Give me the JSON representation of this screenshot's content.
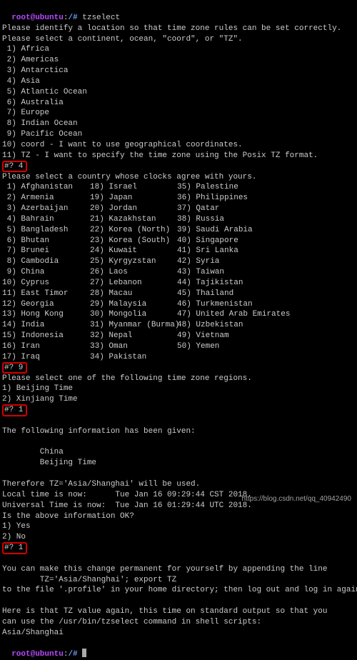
{
  "prompt": {
    "user_host": "root@ubuntu",
    "colon": ":",
    "path": "/#",
    "cmd_tzselect": " tzselect",
    "cmd_end": " "
  },
  "intro": {
    "l1": "Please identify a location so that time zone rules can be set correctly.",
    "l2": "Please select a continent, ocean, \"coord\", or \"TZ\"."
  },
  "continents": [
    " 1) Africa",
    " 2) Americas",
    " 3) Antarctica",
    " 4) Asia",
    " 5) Atlantic Ocean",
    " 6) Australia",
    " 7) Europe",
    " 8) Indian Ocean",
    " 9) Pacific Ocean",
    "10) coord - I want to use geographical coordinates.",
    "11) TZ - I want to specify the time zone using the Posix TZ format."
  ],
  "answer1": "#? 4",
  "country_prompt": "Please select a country whose clocks agree with yours.",
  "countries": [
    {
      "c1": " 1) Afghanistan",
      "c2": "18) Israel",
      "c3": "35) Palestine"
    },
    {
      "c1": " 2) Armenia",
      "c2": "19) Japan",
      "c3": "36) Philippines"
    },
    {
      "c1": " 3) Azerbaijan",
      "c2": "20) Jordan",
      "c3": "37) Qatar"
    },
    {
      "c1": " 4) Bahrain",
      "c2": "21) Kazakhstan",
      "c3": "38) Russia"
    },
    {
      "c1": " 5) Bangladesh",
      "c2": "22) Korea (North)",
      "c3": "39) Saudi Arabia"
    },
    {
      "c1": " 6) Bhutan",
      "c2": "23) Korea (South)",
      "c3": "40) Singapore"
    },
    {
      "c1": " 7) Brunei",
      "c2": "24) Kuwait",
      "c3": "41) Sri Lanka"
    },
    {
      "c1": " 8) Cambodia",
      "c2": "25) Kyrgyzstan",
      "c3": "42) Syria"
    },
    {
      "c1": " 9) China",
      "c2": "26) Laos",
      "c3": "43) Taiwan"
    },
    {
      "c1": "10) Cyprus",
      "c2": "27) Lebanon",
      "c3": "44) Tajikistan"
    },
    {
      "c1": "11) East Timor",
      "c2": "28) Macau",
      "c3": "45) Thailand"
    },
    {
      "c1": "12) Georgia",
      "c2": "29) Malaysia",
      "c3": "46) Turkmenistan"
    },
    {
      "c1": "13) Hong Kong",
      "c2": "30) Mongolia",
      "c3": "47) United Arab Emirates"
    },
    {
      "c1": "14) India",
      "c2": "31) Myanmar (Burma)",
      "c3": "48) Uzbekistan"
    },
    {
      "c1": "15) Indonesia",
      "c2": "32) Nepal",
      "c3": "49) Vietnam"
    },
    {
      "c1": "16) Iran",
      "c2": "33) Oman",
      "c3": "50) Yemen"
    },
    {
      "c1": "17) Iraq",
      "c2": "34) Pakistan",
      "c3": ""
    }
  ],
  "answer2": "#? 9",
  "region_prompt": "Please select one of the following time zone regions.",
  "regions": [
    "1) Beijing Time",
    "2) Xinjiang Time"
  ],
  "answer3": "#? 1",
  "summary": {
    "blank": "",
    "l1": "The following information has been given:",
    "l2": "        China",
    "l3": "        Beijing Time",
    "l4": "Therefore TZ='Asia/Shanghai' will be used.",
    "l5": "Local time is now:      Tue Jan 16 09:29:44 CST 2018.",
    "l6": "Universal Time is now:  Tue Jan 16 01:29:44 UTC 2018.",
    "l7": "Is the above information OK?",
    "y": "1) Yes",
    "n": "2) No"
  },
  "answer4": "#? 1",
  "tail": {
    "l1": "You can make this change permanent for yourself by appending the line",
    "l2": "        TZ='Asia/Shanghai'; export TZ",
    "l3": "to the file '.profile' in your home directory; then log out and log in again.",
    "l4": "Here is that TZ value again, this time on standard output so that you",
    "l5": "can use the /usr/bin/tzselect command in shell scripts:",
    "l6": "Asia/Shanghai"
  },
  "watermark": "https://blog.csdn.net/qq_40942490"
}
